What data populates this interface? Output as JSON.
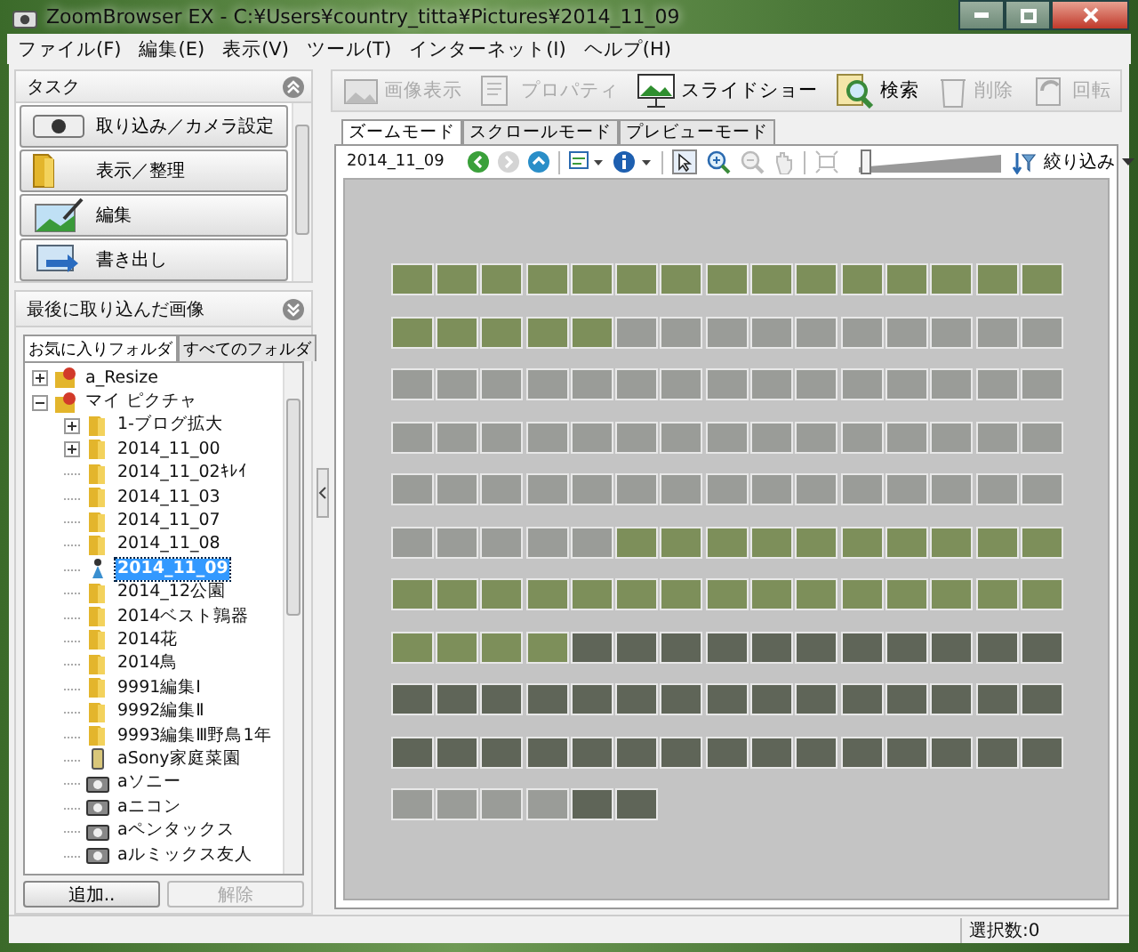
{
  "window": {
    "title": "ZoomBrowser EX  -  C:¥Users¥country_titta¥Pictures¥2014_11_09"
  },
  "menu": [
    "ファイル(F)",
    "編集(E)",
    "表示(V)",
    "ツール(T)",
    "インターネット(I)",
    "ヘルプ(H)"
  ],
  "sidebar": {
    "task_title": "タスク",
    "task_expanded": true,
    "tasks": [
      {
        "label": "取り込み／カメラ設定",
        "kind": "camera"
      },
      {
        "label": "表示／整理",
        "kind": "folder"
      },
      {
        "label": "編集",
        "kind": "edit"
      },
      {
        "label": "書き出し",
        "kind": "export"
      }
    ],
    "recent_title": "最後に取り込んだ画像",
    "recent_expanded": false,
    "tabs": [
      {
        "label": "お気に入りフォルダ",
        "selected": true
      },
      {
        "label": "すべてのフォルダ",
        "selected": false
      }
    ],
    "tree": [
      {
        "label": "a_Resize",
        "kind": "special",
        "expanded": false,
        "selected": false
      },
      {
        "label": "マイ ピクチャ",
        "kind": "special",
        "expanded": true,
        "selected": false,
        "children": [
          {
            "label": "1-ブログ拡大",
            "kind": "folder",
            "expanded": false,
            "selected": false
          },
          {
            "label": "2014_11_00",
            "kind": "folder",
            "expanded": false,
            "selected": false
          },
          {
            "label": "2014_11_02ｷﾚｲ",
            "kind": "folder",
            "selected": false
          },
          {
            "label": "2014_11_03",
            "kind": "folder",
            "selected": false
          },
          {
            "label": "2014_11_07",
            "kind": "folder",
            "selected": false
          },
          {
            "label": "2014_11_08",
            "kind": "folder",
            "selected": false
          },
          {
            "label": "2014_11_09",
            "kind": "current",
            "selected": true
          },
          {
            "label": "2014_12公園",
            "kind": "folder",
            "selected": false
          },
          {
            "label": "2014ベスト鶉器",
            "kind": "folder",
            "selected": false
          },
          {
            "label": "2014花",
            "kind": "folder",
            "selected": false
          },
          {
            "label": "2014鳥",
            "kind": "folder",
            "selected": false
          },
          {
            "label": "9991編集Ⅰ",
            "kind": "folder",
            "selected": false
          },
          {
            "label": "9992編集Ⅱ",
            "kind": "folder",
            "selected": false
          },
          {
            "label": "9993編集Ⅲ野鳥1年",
            "kind": "folder",
            "selected": false
          },
          {
            "label": "aSony家庭菜園",
            "kind": "phone",
            "selected": false
          },
          {
            "label": "aソニー",
            "kind": "camera",
            "selected": false
          },
          {
            "label": "aニコン",
            "kind": "camera",
            "selected": false
          },
          {
            "label": "aペンタックス",
            "kind": "camera",
            "selected": false
          },
          {
            "label": "aルミックス友人",
            "kind": "camera",
            "selected": false
          }
        ]
      }
    ],
    "buttons": [
      {
        "label": "追加..",
        "disabled": false
      },
      {
        "label": "解除",
        "disabled": true
      }
    ]
  },
  "toolbar": [
    {
      "label": "画像表示",
      "kind": "view",
      "disabled": true
    },
    {
      "label": "プロパティ",
      "kind": "props",
      "disabled": true
    },
    {
      "label": "スライドショー",
      "kind": "slideshow",
      "disabled": false
    },
    {
      "label": "検索",
      "kind": "search",
      "disabled": false
    },
    {
      "label": "削除",
      "kind": "trash",
      "disabled": true
    },
    {
      "label": "回転",
      "kind": "rotate",
      "disabled": true
    }
  ],
  "view_tabs": [
    {
      "label": "ズームモード",
      "selected": true
    },
    {
      "label": "スクロールモード",
      "selected": false
    },
    {
      "label": "プレビューモード",
      "selected": false
    }
  ],
  "viewer": {
    "folder": "2014_11_09",
    "zoom": {
      "level": 0.02
    },
    "filter": "絞り込み",
    "thumbnails": [
      {
        "kind": "grass"
      },
      {
        "kind": "grass"
      },
      {
        "kind": "grass"
      },
      {
        "kind": "grass"
      },
      {
        "kind": "grass"
      },
      {
        "kind": "grass"
      },
      {
        "kind": "grass"
      },
      {
        "kind": "grass"
      },
      {
        "kind": "grass"
      },
      {
        "kind": "grass"
      },
      {
        "kind": "grass"
      },
      {
        "kind": "grass"
      },
      {
        "kind": "grass"
      },
      {
        "kind": "grass"
      },
      {
        "kind": "grass"
      },
      {
        "kind": "grass"
      },
      {
        "kind": "grass"
      },
      {
        "kind": "grass"
      },
      {
        "kind": "grass"
      },
      {
        "kind": "grass"
      },
      {
        "kind": "plaza"
      },
      {
        "kind": "plaza"
      },
      {
        "kind": "plaza"
      },
      {
        "kind": "plaza"
      },
      {
        "kind": "plaza"
      },
      {
        "kind": "plaza"
      },
      {
        "kind": "plaza"
      },
      {
        "kind": "plaza"
      },
      {
        "kind": "plaza"
      },
      {
        "kind": "plaza"
      },
      {
        "kind": "plaza"
      },
      {
        "kind": "plaza"
      },
      {
        "kind": "plaza"
      },
      {
        "kind": "plaza"
      },
      {
        "kind": "plaza"
      },
      {
        "kind": "plaza"
      },
      {
        "kind": "plaza"
      },
      {
        "kind": "plaza"
      },
      {
        "kind": "plaza"
      },
      {
        "kind": "plaza"
      },
      {
        "kind": "plaza"
      },
      {
        "kind": "plaza"
      },
      {
        "kind": "plaza"
      },
      {
        "kind": "plaza"
      },
      {
        "kind": "plaza"
      },
      {
        "kind": "plaza"
      },
      {
        "kind": "plaza"
      },
      {
        "kind": "plaza"
      },
      {
        "kind": "plaza"
      },
      {
        "kind": "plaza"
      },
      {
        "kind": "plaza"
      },
      {
        "kind": "plaza"
      },
      {
        "kind": "plaza"
      },
      {
        "kind": "plaza"
      },
      {
        "kind": "plaza"
      },
      {
        "kind": "plaza"
      },
      {
        "kind": "plaza"
      },
      {
        "kind": "plaza"
      },
      {
        "kind": "plaza"
      },
      {
        "kind": "plaza"
      },
      {
        "kind": "plaza"
      },
      {
        "kind": "plaza"
      },
      {
        "kind": "plaza"
      },
      {
        "kind": "plaza"
      },
      {
        "kind": "plaza"
      },
      {
        "kind": "plaza"
      },
      {
        "kind": "plaza"
      },
      {
        "kind": "plaza"
      },
      {
        "kind": "plaza"
      },
      {
        "kind": "plaza"
      },
      {
        "kind": "plaza"
      },
      {
        "kind": "plaza"
      },
      {
        "kind": "plaza"
      },
      {
        "kind": "plaza"
      },
      {
        "kind": "plaza"
      },
      {
        "kind": "plaza"
      },
      {
        "kind": "plaza"
      },
      {
        "kind": "plaza"
      },
      {
        "kind": "plaza"
      },
      {
        "kind": "plaza"
      },
      {
        "kind": "grass"
      },
      {
        "kind": "grass"
      },
      {
        "kind": "grass"
      },
      {
        "kind": "grass"
      },
      {
        "kind": "grass"
      },
      {
        "kind": "grass"
      },
      {
        "kind": "grass"
      },
      {
        "kind": "grass"
      },
      {
        "kind": "grass"
      },
      {
        "kind": "grass"
      },
      {
        "kind": "grass"
      },
      {
        "kind": "grass"
      },
      {
        "kind": "grass"
      },
      {
        "kind": "grass"
      },
      {
        "kind": "grass"
      },
      {
        "kind": "grass"
      },
      {
        "kind": "grass"
      },
      {
        "kind": "grass"
      },
      {
        "kind": "grass"
      },
      {
        "kind": "grass"
      },
      {
        "kind": "grass"
      },
      {
        "kind": "grass"
      },
      {
        "kind": "grass"
      },
      {
        "kind": "grass"
      },
      {
        "kind": "grass"
      },
      {
        "kind": "grass"
      },
      {
        "kind": "grass"
      },
      {
        "kind": "grass"
      },
      {
        "kind": "grass"
      },
      {
        "kind": "pier"
      },
      {
        "kind": "pier"
      },
      {
        "kind": "pier"
      },
      {
        "kind": "pier"
      },
      {
        "kind": "pier"
      },
      {
        "kind": "pier"
      },
      {
        "kind": "pier"
      },
      {
        "kind": "pier"
      },
      {
        "kind": "pier"
      },
      {
        "kind": "pier"
      },
      {
        "kind": "pier"
      },
      {
        "kind": "pier"
      },
      {
        "kind": "pier"
      },
      {
        "kind": "pier"
      },
      {
        "kind": "pier"
      },
      {
        "kind": "pier"
      },
      {
        "kind": "pier"
      },
      {
        "kind": "pier"
      },
      {
        "kind": "pier"
      },
      {
        "kind": "pier"
      },
      {
        "kind": "pier"
      },
      {
        "kind": "pier"
      },
      {
        "kind": "pier"
      },
      {
        "kind": "pier"
      },
      {
        "kind": "pier"
      },
      {
        "kind": "pier"
      },
      {
        "kind": "pier"
      },
      {
        "kind": "pier"
      },
      {
        "kind": "pier"
      },
      {
        "kind": "pier"
      },
      {
        "kind": "pier"
      },
      {
        "kind": "pier"
      },
      {
        "kind": "pier"
      },
      {
        "kind": "pier"
      },
      {
        "kind": "pier"
      },
      {
        "kind": "pier"
      },
      {
        "kind": "pier"
      },
      {
        "kind": "pier"
      },
      {
        "kind": "pier"
      },
      {
        "kind": "pier"
      },
      {
        "kind": "pier"
      },
      {
        "kind": "plaza"
      },
      {
        "kind": "plaza"
      },
      {
        "kind": "plaza"
      },
      {
        "kind": "plaza"
      },
      {
        "kind": "pier"
      },
      {
        "kind": "pier"
      }
    ]
  },
  "status_bar": {
    "selection": "選択数:0"
  }
}
